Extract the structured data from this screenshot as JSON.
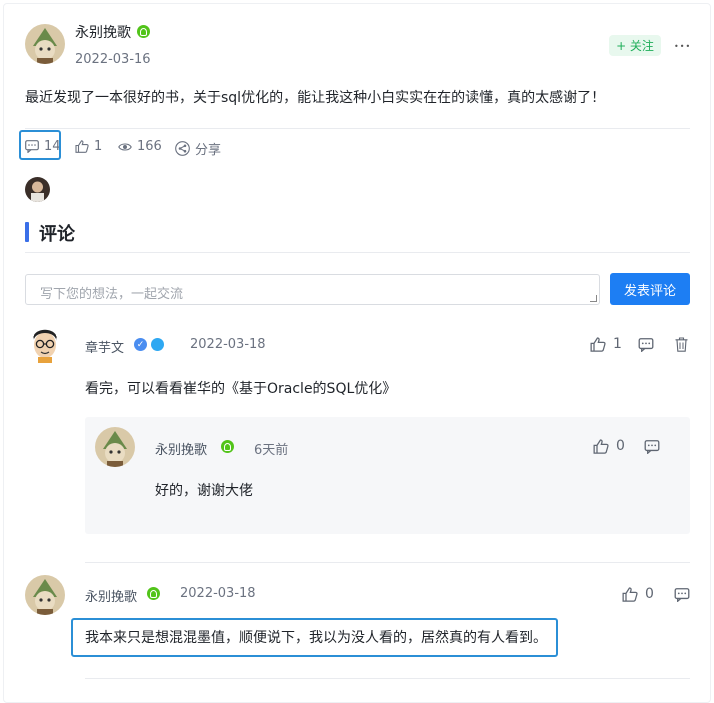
{
  "post": {
    "author": "永别挽歌",
    "date": "2022-03-16",
    "follow_label": "+ 关注",
    "more_label": "•••",
    "content": "最近发现了一本很好的书，关于sql优化的，能让我这种小白实实在在的读懂，真的太感谢了！",
    "stats": {
      "comments": "14",
      "likes": "1",
      "views": "166",
      "share_label": "分享"
    }
  },
  "comments_section": {
    "title": "评论",
    "input_placeholder": "写下您的想法，一起交流",
    "submit_label": "发表评论"
  },
  "comments": [
    {
      "author": "章芋文",
      "date": "2022-03-18",
      "content": "看完，可以看看崔华的《基于Oracle的SQL优化》",
      "likes": "1",
      "reply": {
        "author": "永别挽歌",
        "date": "6天前",
        "content": "好的，谢谢大佬",
        "likes": "0"
      }
    },
    {
      "author": "永别挽歌",
      "date": "2022-03-18",
      "content": "我本来只是想混混墨值，顺便说下，我以为没人看的，居然真的有人看到。",
      "likes": "0"
    }
  ],
  "colors": {
    "accent": "#1d7ef3",
    "follow_green": "#1fae5a",
    "highlight": "#2b8fd6",
    "section_bar": "#3a6fe8"
  }
}
